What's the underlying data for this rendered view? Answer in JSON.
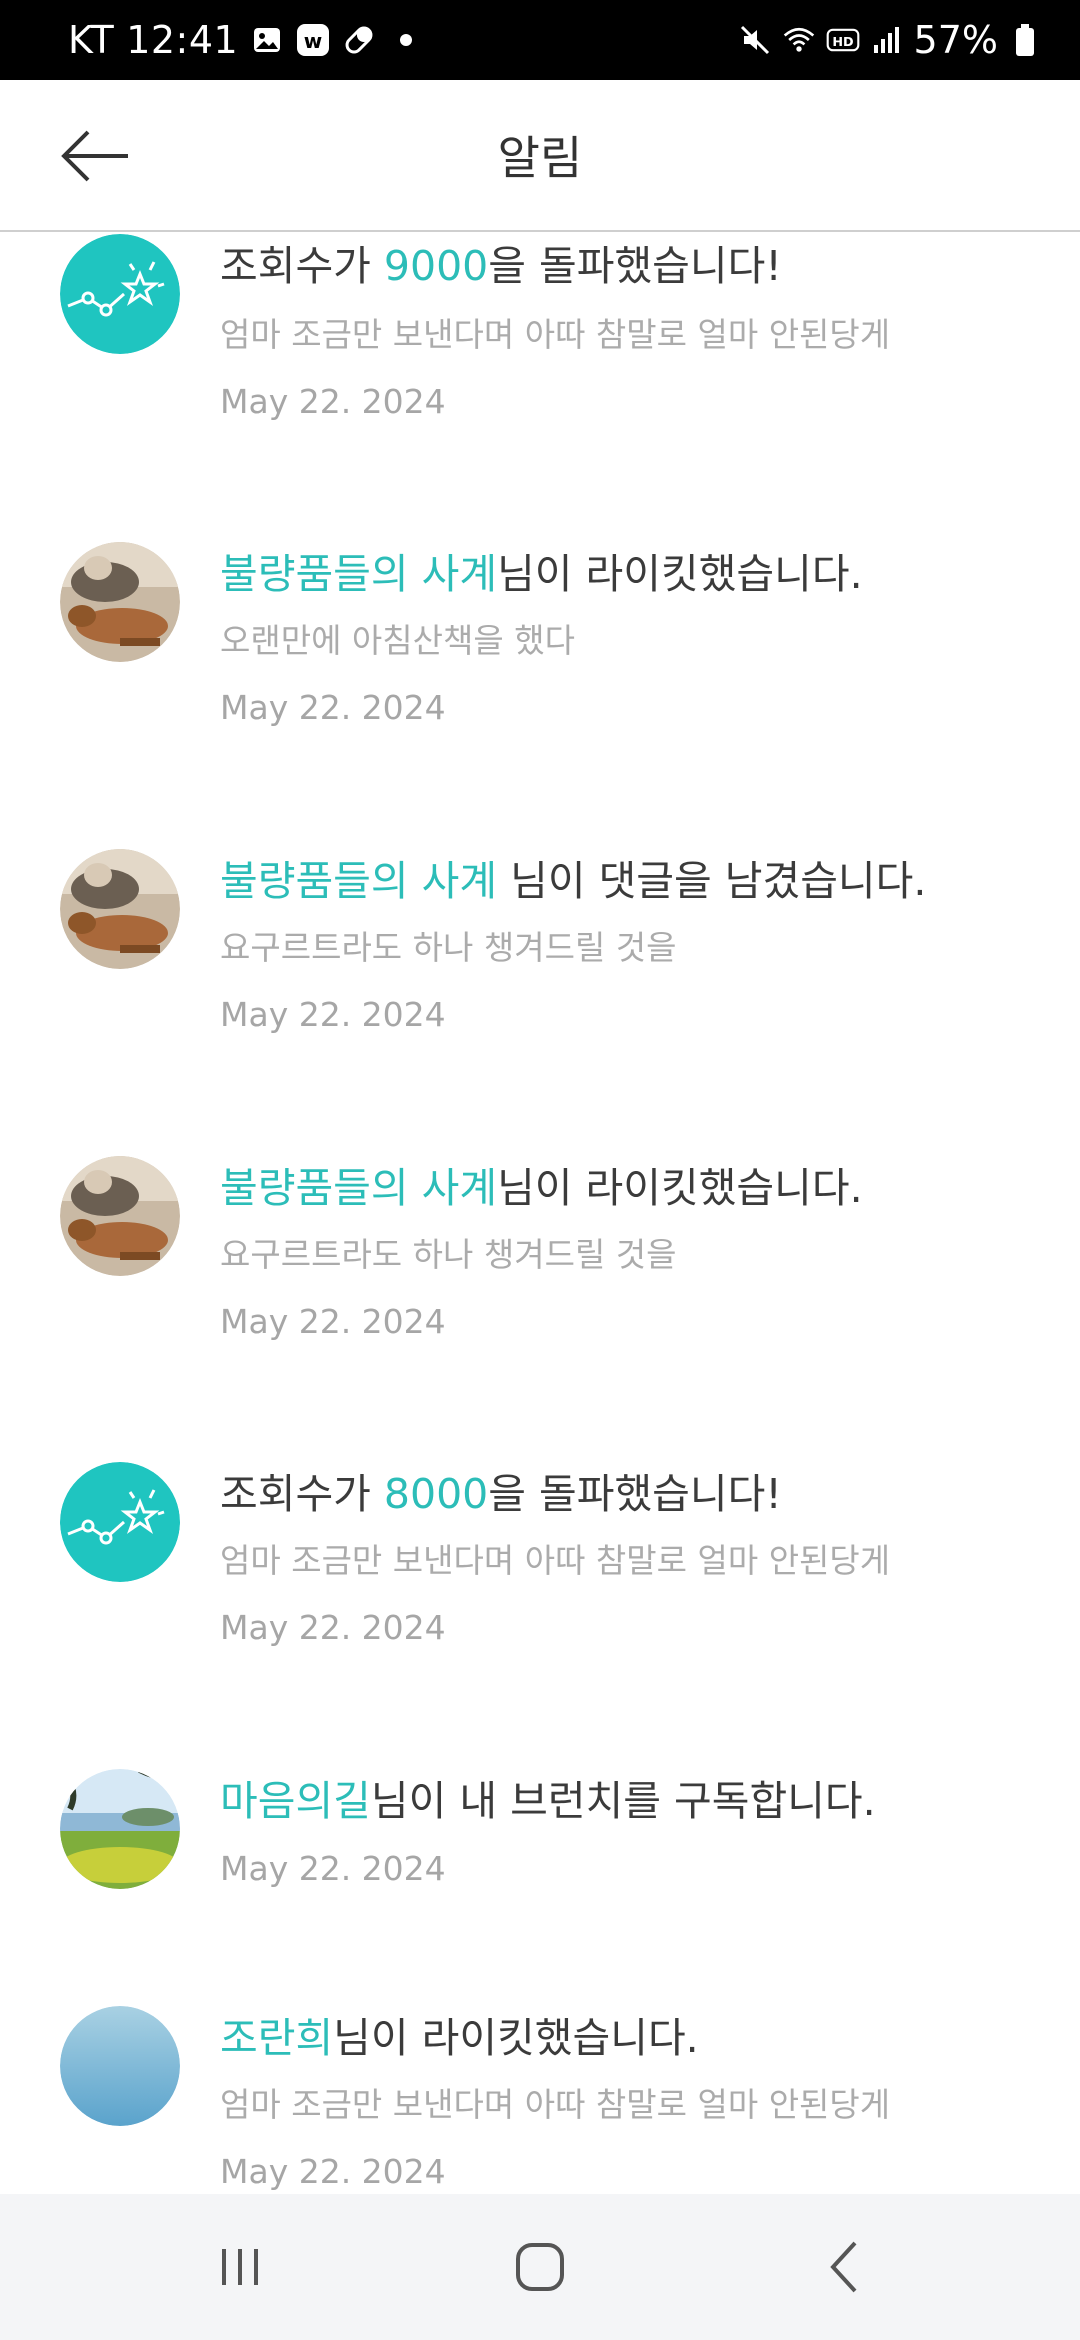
{
  "status_bar": {
    "carrier": "KT",
    "time": "12:41",
    "battery": "57%"
  },
  "header": {
    "title": "알림"
  },
  "notifications": [
    {
      "avatar": "stats-star-icon",
      "before": "조회수가 ",
      "highlight": "9000",
      "after": "을 돌파했습니다!",
      "subtitle": "엄마 조금만 보낸다며 아따 참말로 얼마 안된당게",
      "date": "May 22. 2024"
    },
    {
      "avatar": "user-photo-dog",
      "before": "",
      "highlight": "불량품들의 사계",
      "after": "님이 라이킷했습니다.",
      "subtitle": "오랜만에 아침산책을 했다",
      "date": "May 22. 2024"
    },
    {
      "avatar": "user-photo-dog",
      "before": "",
      "highlight": "불량품들의 사계",
      "after": " 님이 댓글을 남겼습니다.",
      "subtitle": "요구르트라도 하나 챙겨드릴 것을",
      "date": "May 22. 2024"
    },
    {
      "avatar": "user-photo-dog",
      "before": "",
      "highlight": "불량품들의 사계",
      "after": "님이 라이킷했습니다.",
      "subtitle": "요구르트라도 하나 챙겨드릴 것을",
      "date": "May 22. 2024"
    },
    {
      "avatar": "stats-star-icon",
      "before": "조회수가 ",
      "highlight": "8000",
      "after": "을 돌파했습니다!",
      "subtitle": "엄마 조금만 보낸다며 아따 참말로 얼마 안된당게",
      "date": "May 22. 2024"
    },
    {
      "avatar": "user-photo-landscape",
      "before": "",
      "highlight": "마음의길",
      "after": "님이 내 브런치를 구독합니다.",
      "subtitle": "",
      "date": "May 22. 2024"
    },
    {
      "avatar": "user-default-blue",
      "before": "",
      "highlight": "조란희",
      "after": "님이 라이킷했습니다.",
      "subtitle": "엄마 조금만 보낸다며 아따 참말로 얼마 안된당게",
      "date": "May 22. 2024"
    }
  ],
  "colors": {
    "accent": "#2cbdb8",
    "text": "#3b3b3b",
    "muted": "#ababab"
  }
}
